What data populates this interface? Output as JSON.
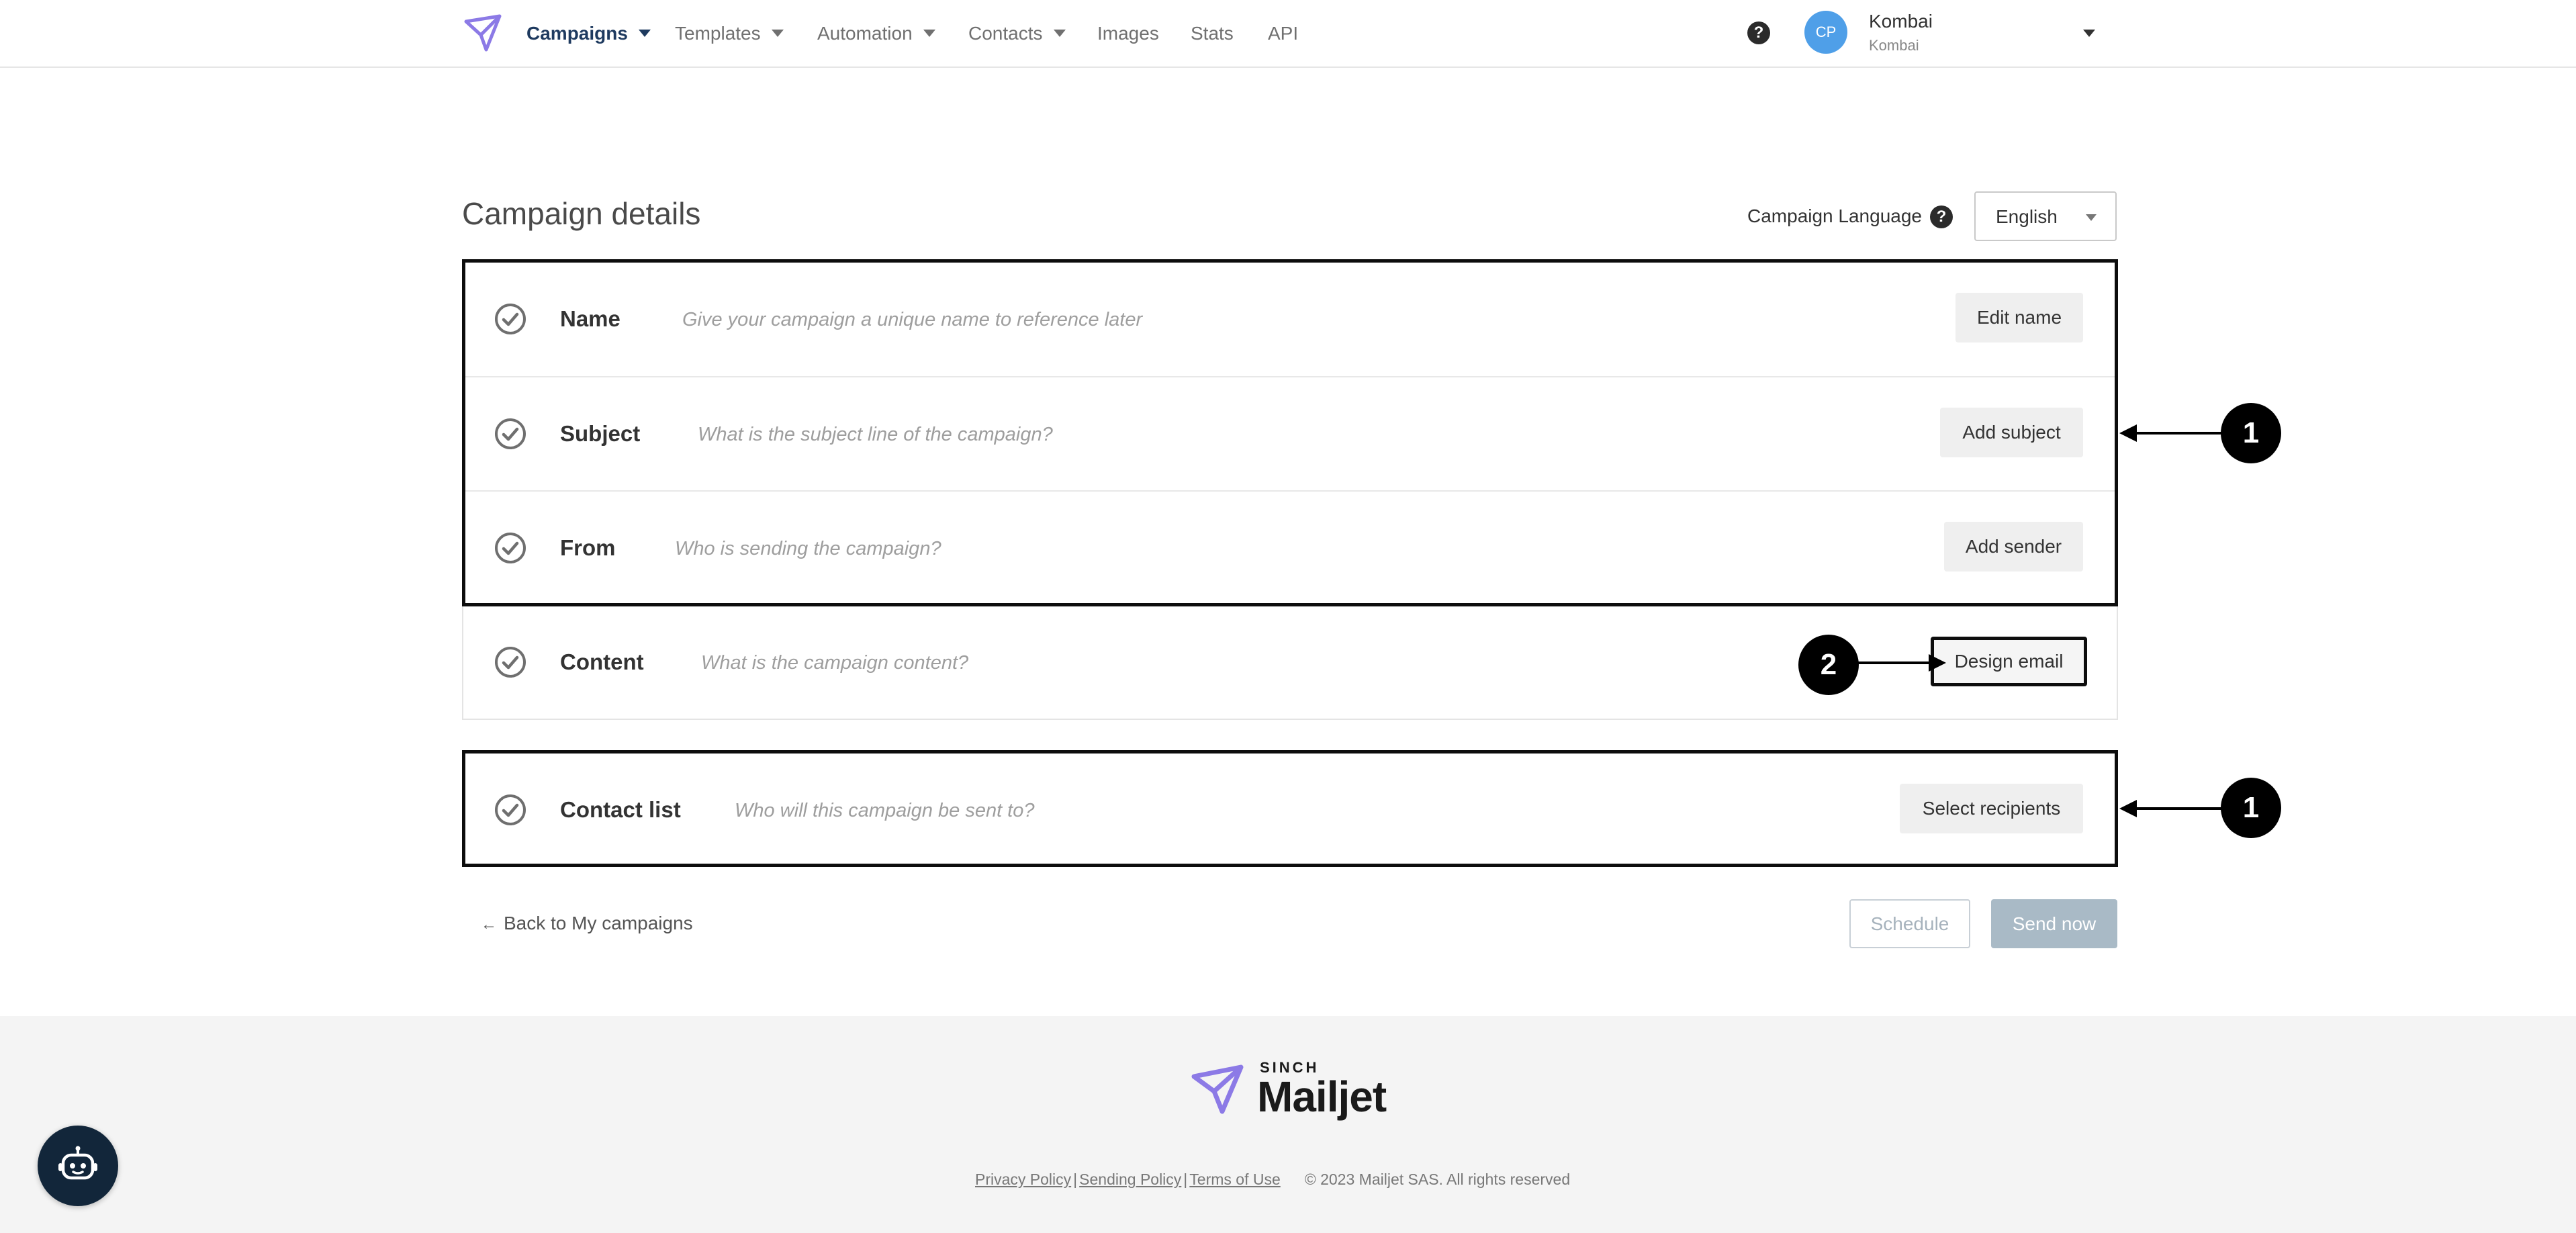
{
  "nav": {
    "items": [
      {
        "label": "Campaigns",
        "has_caret": true,
        "active": true
      },
      {
        "label": "Templates",
        "has_caret": true,
        "active": false
      },
      {
        "label": "Automation",
        "has_caret": true,
        "active": false
      },
      {
        "label": "Contacts",
        "has_caret": true,
        "active": false
      },
      {
        "label": "Images",
        "has_caret": false,
        "active": false
      },
      {
        "label": "Stats",
        "has_caret": false,
        "active": false
      },
      {
        "label": "API",
        "has_caret": false,
        "active": false
      }
    ],
    "help_icon": "?",
    "user": {
      "initials": "CP",
      "name": "Kombai",
      "account": "Kombai"
    }
  },
  "header": {
    "title": "Campaign details",
    "language_label": "Campaign Language",
    "language_help": "?",
    "language_value": "English"
  },
  "rows": [
    {
      "label": "Name",
      "hint": "Give your campaign a unique name to reference later",
      "button": "Edit name"
    },
    {
      "label": "Subject",
      "hint": "What is the subject line of the campaign?",
      "button": "Add subject"
    },
    {
      "label": "From",
      "hint": "Who is sending the campaign?",
      "button": "Add sender"
    },
    {
      "label": "Content",
      "hint": "What is the campaign content?",
      "button": "Design email"
    },
    {
      "label": "Contact list",
      "hint": "Who will this campaign be sent to?",
      "button": "Select recipients"
    }
  ],
  "callouts": {
    "first": "1",
    "second": "2",
    "third": "1"
  },
  "actions": {
    "back_arrow": "←",
    "back_label": "Back to My campaigns",
    "schedule": "Schedule",
    "send_now": "Send now"
  },
  "footer": {
    "brand_top": "SINCH",
    "brand_name": "Mailjet",
    "links": [
      "Privacy Policy",
      "Sending Policy",
      "Terms of Use"
    ],
    "link_separator": "|",
    "copyright": "© 2023 Mailjet SAS. All rights reserved"
  },
  "colors": {
    "accent_nav": "#1e3a5f",
    "brand_purple": "#8c7ae6",
    "avatar": "#4f9fe8",
    "send_button": "#a9bac6",
    "bot_button": "#12263a"
  },
  "icons": {
    "logo": "paper-plane-icon",
    "row_status": "check-circle-icon",
    "chatbot": "robot-icon"
  }
}
